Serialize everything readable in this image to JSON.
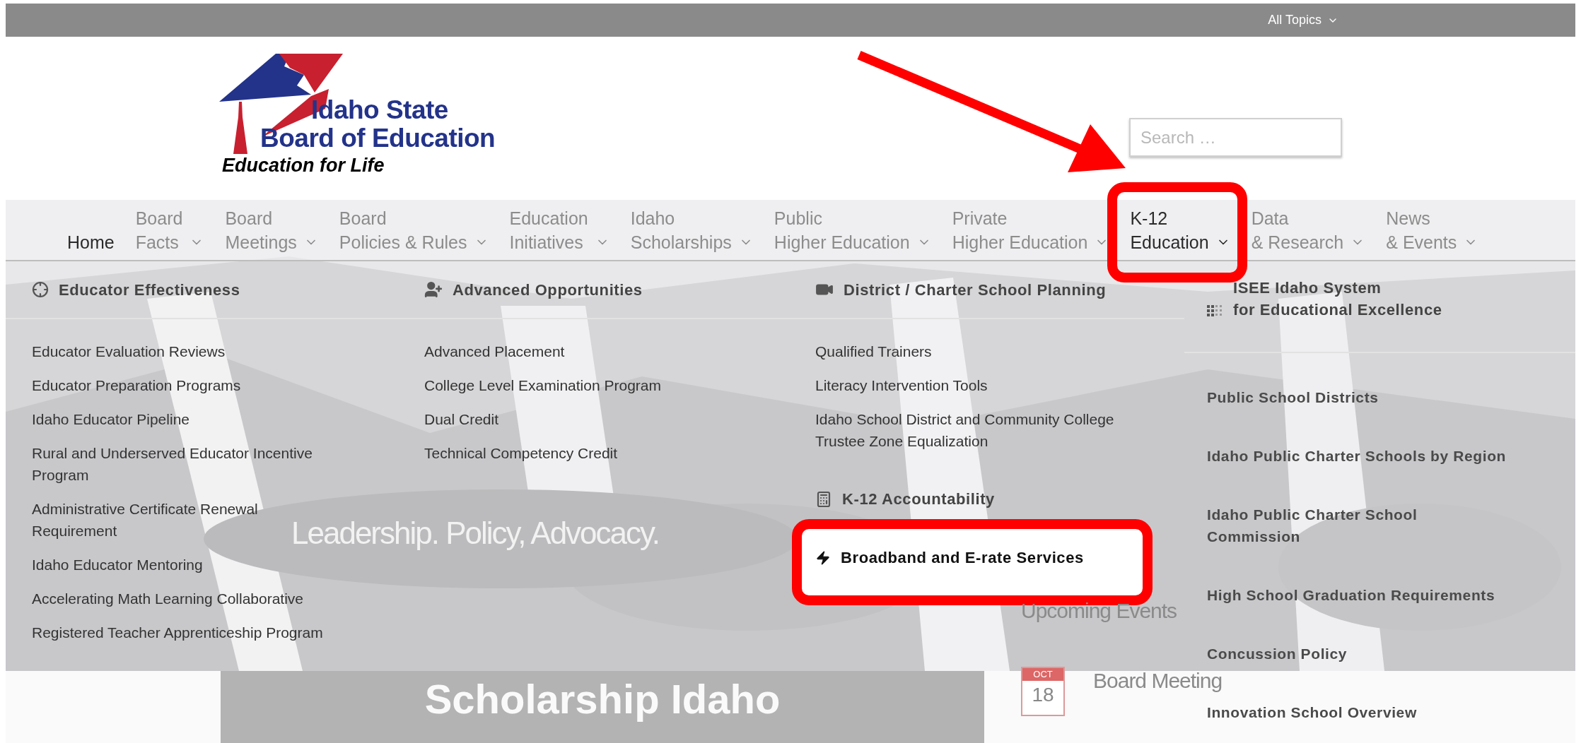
{
  "top_bar": {
    "menu": "All Topics"
  },
  "logo": {
    "line1": "Idaho State",
    "line2": "Board of Education",
    "tagline": "Education for Life"
  },
  "search": {
    "placeholder": "Search …"
  },
  "nav": [
    {
      "lines": [
        "Home"
      ],
      "dropdown": false,
      "current": true,
      "highlighted": false
    },
    {
      "lines": [
        "Board",
        "Facts"
      ],
      "dropdown": true,
      "current": false,
      "highlighted": false
    },
    {
      "lines": [
        "Board",
        "Meetings"
      ],
      "dropdown": true,
      "current": false,
      "highlighted": false
    },
    {
      "lines": [
        "Board",
        "Policies & Rules"
      ],
      "dropdown": true,
      "current": false,
      "highlighted": false
    },
    {
      "lines": [
        "Education",
        "Initiatives"
      ],
      "dropdown": true,
      "current": false,
      "highlighted": false
    },
    {
      "lines": [
        "Idaho",
        "Scholarships"
      ],
      "dropdown": true,
      "current": false,
      "highlighted": false
    },
    {
      "lines": [
        "Public",
        "Higher Education"
      ],
      "dropdown": true,
      "current": false,
      "highlighted": false
    },
    {
      "lines": [
        "Private",
        "Higher Education"
      ],
      "dropdown": true,
      "current": false,
      "highlighted": false
    },
    {
      "lines": [
        "K-12",
        "Education"
      ],
      "dropdown": true,
      "current": true,
      "highlighted": true
    },
    {
      "lines": [
        "Data",
        "& Research"
      ],
      "dropdown": true,
      "current": false,
      "highlighted": false
    },
    {
      "lines": [
        "News",
        "& Events"
      ],
      "dropdown": true,
      "current": false,
      "highlighted": false
    }
  ],
  "hero": {
    "tagline": "Leadership. Policy, Advocacy."
  },
  "scholarship": {
    "title": "Scholarship Idaho"
  },
  "events": {
    "title": "Upcoming Events",
    "items": [
      {
        "month": "OCT",
        "day": "18",
        "title": "Board Meeting"
      }
    ]
  },
  "menu": {
    "columns": [
      {
        "kind": "links",
        "sections": [
          {
            "heading": [
              "Educator Effectiveness"
            ],
            "highlighted": false,
            "links": [
              {
                "lines": [
                  "Educator Evaluation Reviews"
                ]
              },
              {
                "lines": [
                  "Educator Preparation Programs"
                ]
              },
              {
                "lines": [
                  "Idaho Educator Pipeline"
                ]
              },
              {
                "lines": [
                  "Rural and Underserved Educator Incentive",
                  "Program"
                ]
              },
              {
                "lines": [
                  "Administrative Certificate Renewal",
                  "Requirement"
                ]
              },
              {
                "lines": [
                  "Idaho Educator Mentoring"
                ]
              },
              {
                "lines": [
                  "Accelerating Math Learning Collaborative"
                ]
              },
              {
                "lines": [
                  "Registered Teacher Apprenticeship Program"
                ]
              }
            ]
          }
        ]
      },
      {
        "kind": "links",
        "sections": [
          {
            "heading": [
              "Advanced Opportunities"
            ],
            "highlighted": false,
            "links": [
              {
                "lines": [
                  "Advanced Placement"
                ]
              },
              {
                "lines": [
                  "College Level Examination Program"
                ]
              },
              {
                "lines": [
                  "Dual Credit"
                ]
              },
              {
                "lines": [
                  "Technical Competency Credit"
                ]
              }
            ]
          }
        ]
      },
      {
        "kind": "links",
        "sections": [
          {
            "heading": [
              "District / Charter School Planning"
            ],
            "highlighted": false,
            "links": [
              {
                "lines": [
                  "Qualified Trainers"
                ]
              },
              {
                "lines": [
                  "Literacy Intervention Tools"
                ]
              },
              {
                "lines": [
                  "Idaho School District and Community College",
                  "Trustee Zone Equalization"
                ]
              }
            ]
          },
          {
            "heading": [
              "K-12 Accountability"
            ],
            "highlighted": false
          },
          {
            "heading": [
              "Broadband and E-rate Services"
            ],
            "highlighted": true
          }
        ]
      },
      {
        "kind": "featured",
        "sections": [
          {
            "heading": [
              "ISEE Idaho System",
              "for Educational Excellence"
            ],
            "highlighted": false,
            "links": [
              {
                "lines": [
                  "Public School Districts"
                ]
              },
              {
                "lines": [
                  "Idaho Public Charter Schools by Region"
                ]
              },
              {
                "lines": [
                  "Idaho Public Charter School",
                  "Commission"
                ]
              },
              {
                "lines": [
                  "High School Graduation Requirements"
                ]
              },
              {
                "lines": [
                  "Concussion Policy"
                ]
              },
              {
                "lines": [
                  "Innovation School Overview"
                ]
              }
            ]
          }
        ]
      }
    ]
  }
}
